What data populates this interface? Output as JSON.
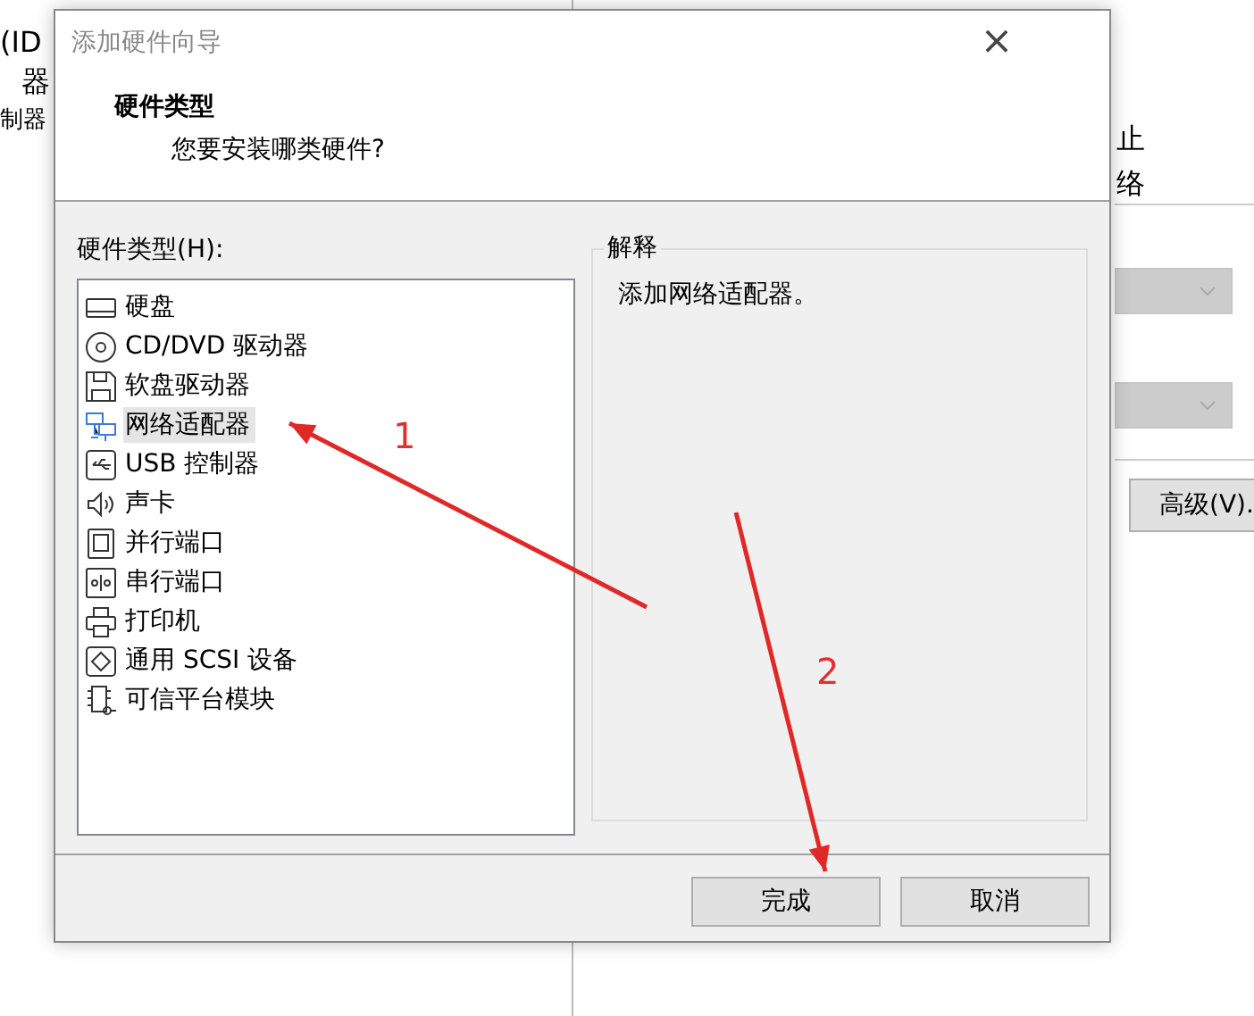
{
  "background_window": {
    "left_texts": [
      "(ID",
      "器",
      "制器"
    ],
    "right_texts": [
      "止",
      "络"
    ],
    "dropdowns": [
      {
        "disabled": true
      },
      {
        "disabled": true
      }
    ],
    "button": "高级(V)."
  },
  "dialog": {
    "title": "添加硬件向导",
    "close": "×",
    "header": {
      "title": "硬件类型",
      "subtitle": "您要安装哪类硬件?"
    },
    "list_label": "硬件类型(H):",
    "items": [
      {
        "label": "硬盘",
        "kind": "disk",
        "selected": false
      },
      {
        "label": "CD/DVD 驱动器",
        "kind": "optical",
        "selected": false
      },
      {
        "label": "软盘驱动器",
        "kind": "floppy",
        "selected": false
      },
      {
        "label": "网络适配器",
        "kind": "network",
        "selected": true
      },
      {
        "label": "USB 控制器",
        "kind": "usb",
        "selected": false
      },
      {
        "label": "声卡",
        "kind": "sound",
        "selected": false
      },
      {
        "label": "并行端口",
        "kind": "parallel",
        "selected": false
      },
      {
        "label": "串行端口",
        "kind": "serial",
        "selected": false
      },
      {
        "label": "打印机",
        "kind": "printer",
        "selected": false
      },
      {
        "label": "通用 SCSI 设备",
        "kind": "scsi",
        "selected": false
      },
      {
        "label": "可信平台模块",
        "kind": "tpm",
        "selected": false
      }
    ],
    "explanation": {
      "title": "解释",
      "text": "添加网络适配器。"
    },
    "buttons": [
      {
        "label": "完成"
      },
      {
        "label": "取消"
      }
    ]
  },
  "annotations": [
    {
      "label": "1"
    },
    {
      "label": "2"
    }
  ]
}
